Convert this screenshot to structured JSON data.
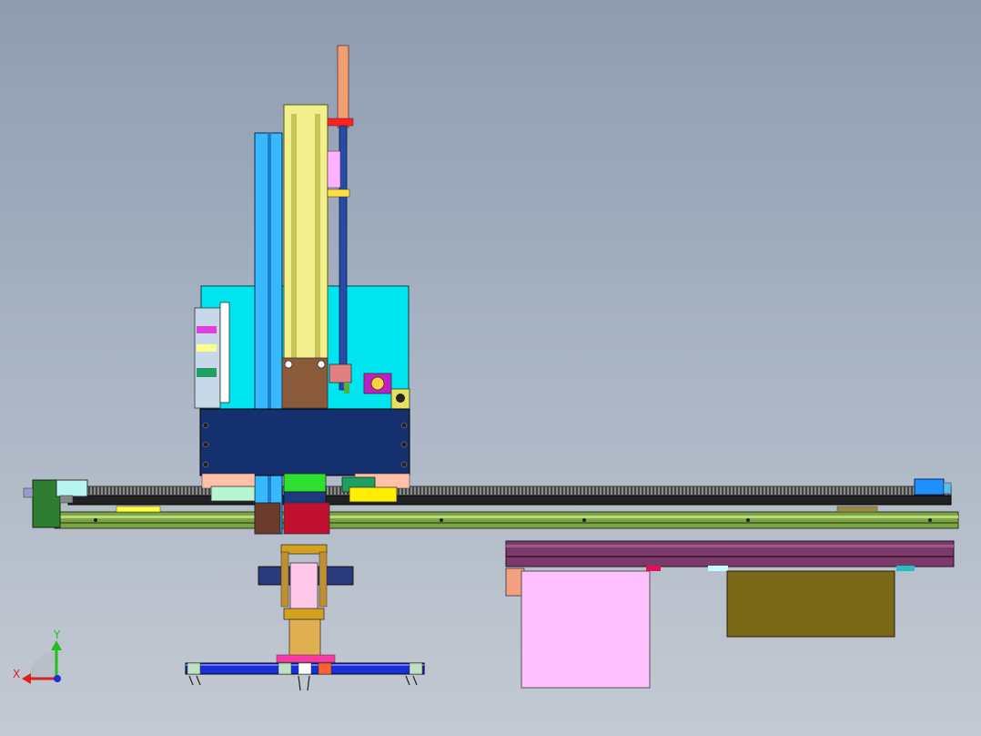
{
  "viewport": {
    "background_top": "#8f9cb0",
    "background_bottom": "#c4cad3",
    "colors": {
      "cyan_block": "#00e5f0",
      "navy_carriage": "#15306e",
      "yellow_column": "#f2f08c",
      "rail_green": "#7da347",
      "rack_grey": "#6a6a6a",
      "pink_box": "#ffc0ff",
      "olive_box": "#7a6717",
      "purple_plate": "#7a3a6a",
      "blue_beam": "#1a2ed6",
      "copper_rod": "#f0a070",
      "motor_green": "#2e7d32"
    }
  },
  "triad": {
    "x_label": "X",
    "y_label": "Y",
    "x_axis_color": "#e02020",
    "y_axis_color": "#20c020",
    "z_dot_color": "#2030d0"
  },
  "parts": [
    "gantry-rail",
    "gear-rack",
    "carriage-plate",
    "cyan-housing",
    "vertical-column",
    "vertical-rod",
    "gripper-cylinder",
    "gripper-beam",
    "conveyor-plate",
    "pink-fixture",
    "olive-fixture",
    "end-motor-left",
    "end-stop-right"
  ]
}
